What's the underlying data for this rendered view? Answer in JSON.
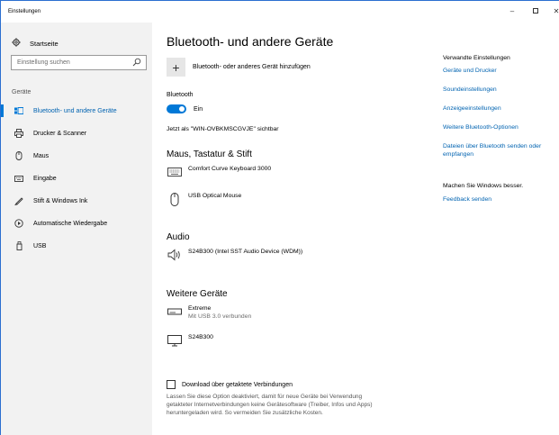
{
  "window": {
    "title": "Einstellungen",
    "controls": {
      "minimize": "–",
      "close": "✕"
    }
  },
  "sidebar": {
    "home_label": "Startseite",
    "search_placeholder": "Einstellung suchen",
    "section_label": "Geräte",
    "items": [
      {
        "label": "Bluetooth- und andere Geräte",
        "icon": "bluetooth-devices-icon",
        "active": true
      },
      {
        "label": "Drucker & Scanner",
        "icon": "printer-icon",
        "active": false
      },
      {
        "label": "Maus",
        "icon": "mouse-icon",
        "active": false
      },
      {
        "label": "Eingabe",
        "icon": "keyboard-icon",
        "active": false
      },
      {
        "label": "Stift & Windows Ink",
        "icon": "pen-icon",
        "active": false
      },
      {
        "label": "Automatische Wiedergabe",
        "icon": "autoplay-icon",
        "active": false
      },
      {
        "label": "USB",
        "icon": "usb-icon",
        "active": false
      }
    ]
  },
  "main": {
    "title": "Bluetooth- und andere Geräte",
    "add_device_label": "Bluetooth- oder anderes Gerät hinzufügen",
    "bluetooth_heading": "Bluetooth",
    "toggle_label": "Ein",
    "toggle_on": true,
    "visible_as": "Jetzt als \"WIN-OVBKMSCGVJE\" sichtbar",
    "sections": {
      "input": {
        "title": "Maus, Tastatur & Stift",
        "devices": [
          {
            "name": "Comfort Curve Keyboard 3000",
            "icon": "keyboard-icon"
          },
          {
            "name": "USB Optical Mouse",
            "icon": "mouse-icon"
          }
        ]
      },
      "audio": {
        "title": "Audio",
        "devices": [
          {
            "name": "S24B300 (Intel SST Audio Device (WDM))",
            "icon": "speaker-icon"
          }
        ]
      },
      "other": {
        "title": "Weitere Geräte",
        "devices": [
          {
            "name": "Extreme",
            "status": "Mit USB 3.0 verbunden",
            "icon": "usb-drive-icon"
          },
          {
            "name": "S24B300",
            "icon": "monitor-icon"
          }
        ]
      }
    },
    "metered": {
      "label": "Download über getaktete Verbindungen",
      "checked": false,
      "description": "Lassen Sie diese Option deaktiviert, damit für neue Geräte bei Verwendung getakteter Internetverbindungen keine Gerätesoftware (Treiber, Infos und Apps) heruntergeladen wird. So vermeiden Sie zusätzliche Kosten."
    }
  },
  "related": {
    "heading": "Verwandte Einstellungen",
    "links": [
      "Geräte und Drucker",
      "Soundeinstellungen",
      "Anzeigeeinstellungen",
      "Weitere Bluetooth-Optionen",
      "Dateien über Bluetooth senden oder empfangen"
    ],
    "feedback_heading": "Machen Sie Windows besser.",
    "feedback_link": "Feedback senden"
  },
  "colors": {
    "accent": "#0078d7",
    "link": "#0063b1",
    "sidebar_bg": "#f2f2f2"
  }
}
